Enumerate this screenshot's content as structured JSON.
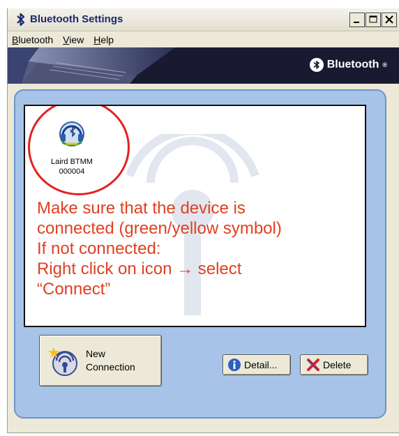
{
  "window": {
    "title": "Bluetooth Settings"
  },
  "menu": {
    "items": [
      {
        "accel": "B",
        "rest": "luetooth"
      },
      {
        "accel": "V",
        "rest": "iew"
      },
      {
        "accel": "H",
        "rest": "elp"
      }
    ]
  },
  "banner": {
    "brand": "Bluetooth",
    "trademark": "®"
  },
  "device": {
    "name_line1": "Laird BTMM",
    "name_line2": "000004",
    "icon": "headset-connected-icon"
  },
  "instructions": {
    "line1": "Make sure that the device is",
    "line2": "connected (green/yellow symbol)",
    "line3": "If not connected:",
    "line4": "Right click on icon → select",
    "line5": "“Connect”"
  },
  "buttons": {
    "new_line1": "New",
    "new_line2": "Connection",
    "detail": "Detail...",
    "delete": "Delete"
  },
  "colors": {
    "annotation": "#e04020",
    "circle": "#e0231f",
    "panel": "#a7c3e8",
    "banner": "#191a31",
    "title": "#1c2a6e"
  }
}
